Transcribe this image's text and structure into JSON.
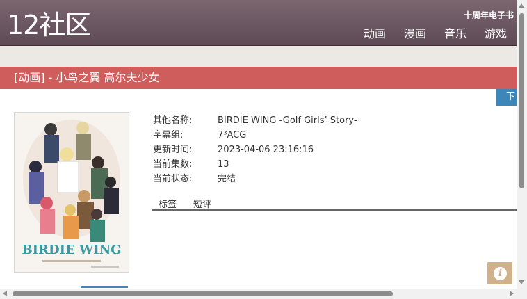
{
  "site": {
    "logo": "12社区",
    "ebook_link": "十周年电子书",
    "nav": [
      "动画",
      "漫画",
      "音乐",
      "游戏"
    ]
  },
  "page": {
    "title": "[动画] - 小鸟之翼 高尔夫少女",
    "download_tab": "下",
    "cover_alt_text": "BIRDIE WING"
  },
  "info": [
    {
      "label": "其他名称:",
      "value": "BIRDIE WING -Golf Girls’ Story-"
    },
    {
      "label": "字幕组:",
      "value": "7³ACG"
    },
    {
      "label": "更新时间:",
      "value": "2023-04-06 23:16:16"
    },
    {
      "label": "当前集数:",
      "value": "13"
    },
    {
      "label": "当前状态:",
      "value": "完结"
    }
  ],
  "tabs": [
    "标签",
    "短评"
  ],
  "info_icon": "i",
  "colors": {
    "header": "#6d5862",
    "title_bar": "#cf5d5c",
    "accent_blue": "#3f86b8",
    "info_icon_bg": "#cfb28c"
  },
  "icons": {
    "info": "info-icon",
    "scroll_up": "chevron-up-icon",
    "scroll_down": "chevron-down-icon",
    "scroll_left": "chevron-left-icon",
    "scroll_right": "chevron-right-icon"
  }
}
